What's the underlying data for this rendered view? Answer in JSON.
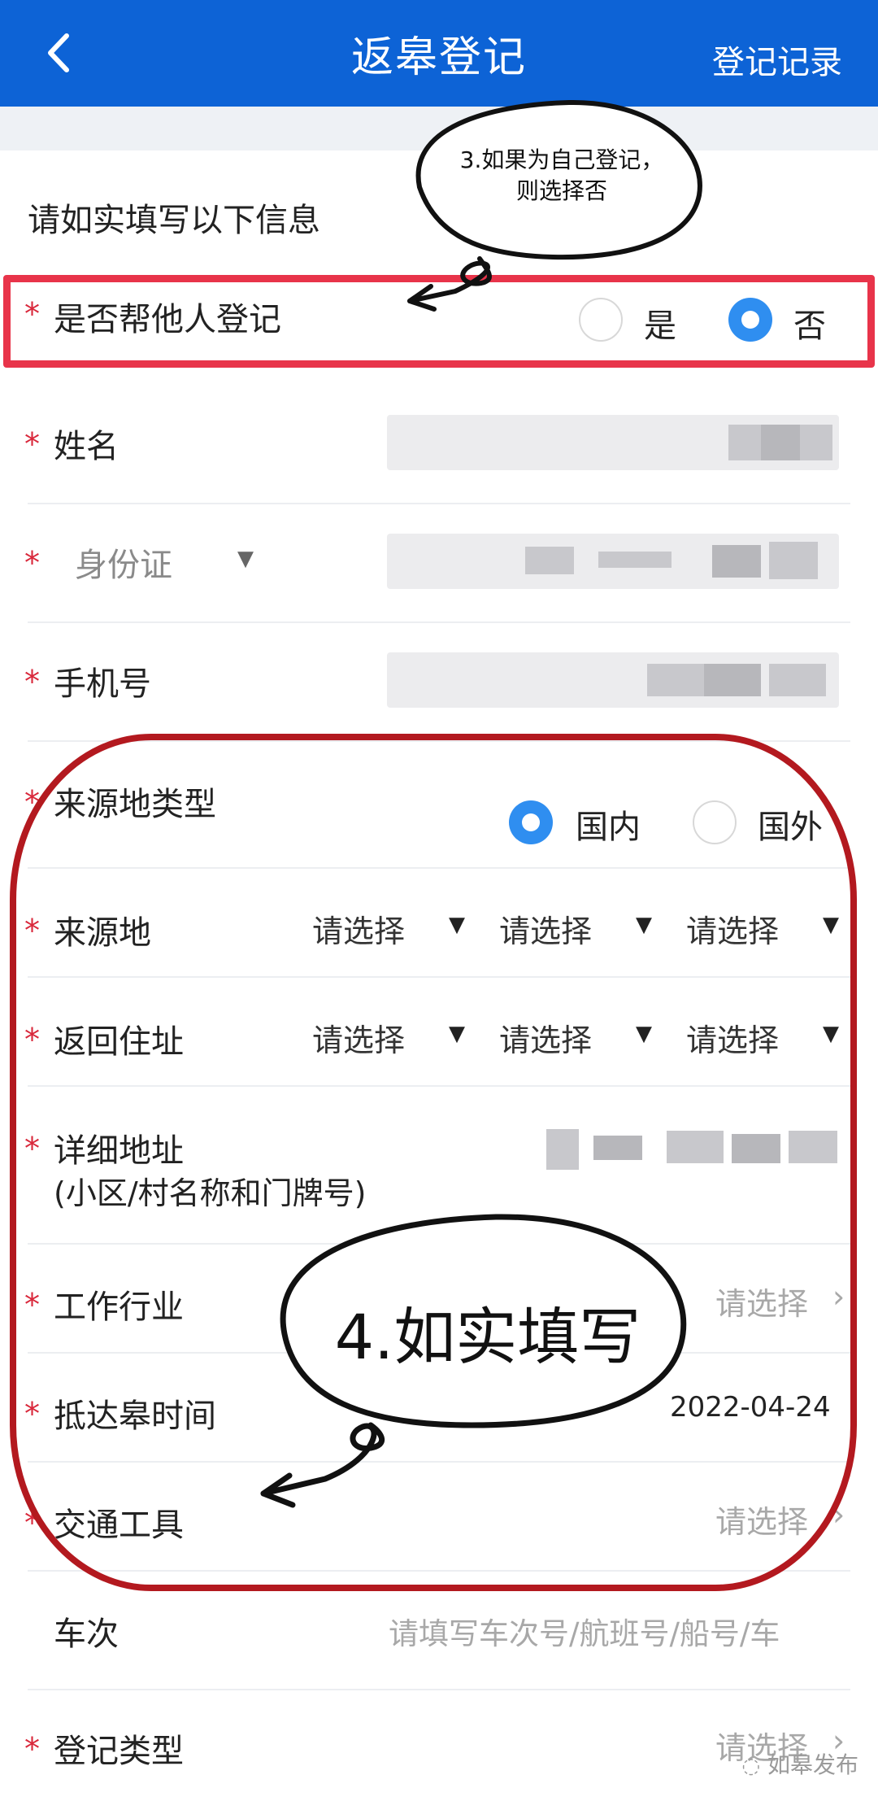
{
  "header": {
    "back_icon": "chevron-left-icon",
    "title": "返皋登记",
    "records_link": "登记记录"
  },
  "intro": "请如实填写以下信息",
  "annotations": {
    "note3": "3.如果为自己登记，\n则选择否",
    "note4": "4.如实填写"
  },
  "fields": {
    "help_register": {
      "label": "是否帮他人登记",
      "options": [
        "是",
        "否"
      ],
      "selected": "否"
    },
    "name": {
      "label": "姓名"
    },
    "id_type": {
      "label": "身份证"
    },
    "phone": {
      "label": "手机号"
    },
    "origin_type": {
      "label": "来源地类型",
      "options": [
        "国内",
        "国外"
      ],
      "selected": "国内"
    },
    "origin": {
      "label": "来源地",
      "selects": [
        "请选择",
        "请选择",
        "请选择"
      ]
    },
    "return_address": {
      "label": "返回住址",
      "selects": [
        "请选择",
        "请选择",
        "请选择"
      ]
    },
    "detail_address": {
      "label": "详细地址",
      "sublabel": "(小区/村名称和门牌号)"
    },
    "industry": {
      "label": "工作行业",
      "value": "请选择"
    },
    "arrival_time": {
      "label": "抵达皋时间",
      "value": "2022-04-24"
    },
    "transport": {
      "label": "交通工具",
      "value": "请选择"
    },
    "train_no": {
      "label": "车次",
      "placeholder": "请填写车次号/航班号/船号/车"
    },
    "register_type": {
      "label": "登记类型",
      "value": "请选择"
    }
  },
  "watermark": "如皋发布",
  "colors": {
    "header_bg": "#0d63d6",
    "accent": "#2f8ef0",
    "required": "#d9283b",
    "highlight": "#e8344a",
    "oval": "#b3191f"
  }
}
